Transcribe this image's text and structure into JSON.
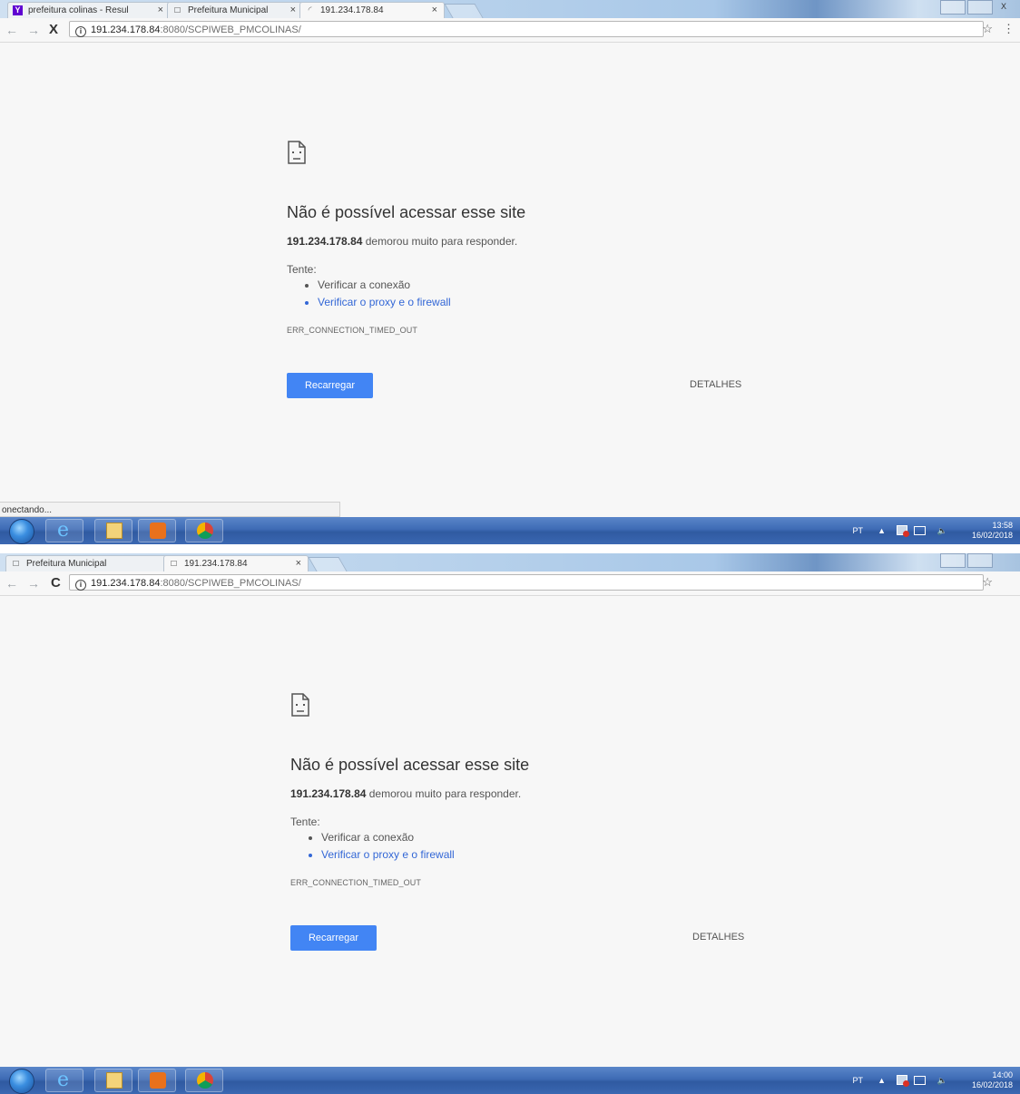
{
  "screens": [
    {
      "tabs": [
        {
          "icon": "yahoo-icon",
          "label": "prefeitura colinas - Resul",
          "close": "×"
        },
        {
          "icon": "page-icon",
          "label": "Prefeitura Municipal",
          "close": "×"
        },
        {
          "icon": "loading-icon",
          "label": "191.234.178.84",
          "close": "×"
        }
      ],
      "url": {
        "host": "191.234.178.84",
        "path": ":8080/SCPIWEB_PMCOLINAS/"
      },
      "reload_symbol": "X",
      "error": {
        "headline": "Não é possível acessar esse site",
        "host": "191.234.178.84",
        "reason": " demorou muito para responder.",
        "try_label": "Tente:",
        "suggestions": [
          "Verificar a conexão",
          "Verificar o proxy e o firewall"
        ],
        "code": "ERR_CONNECTION_TIMED_OUT",
        "reload_button": "Recarregar",
        "details_button": "DETALHES"
      },
      "status_text": "onectando...",
      "tray": {
        "lang": "PT",
        "time": "13:58",
        "date": "16/02/2018"
      }
    },
    {
      "tabs": [
        {
          "icon": "page-icon",
          "label": "Prefeitura Municipal",
          "close": "×"
        },
        {
          "icon": "page-icon",
          "label": "191.234.178.84",
          "close": "×"
        }
      ],
      "url": {
        "host": "191.234.178.84",
        "path": ":8080/SCPIWEB_PMCOLINAS/"
      },
      "reload_symbol": "C",
      "error": {
        "headline": "Não é possível acessar esse site",
        "host": "191.234.178.84",
        "reason": " demorou muito para responder.",
        "try_label": "Tente:",
        "suggestions": [
          "Verificar a conexão",
          "Verificar o proxy e o firewall"
        ],
        "code": "ERR_CONNECTION_TIMED_OUT",
        "reload_button": "Recarregar",
        "details_button": "DETALHES"
      },
      "tray": {
        "lang": "PT",
        "time": "14:00",
        "date": "16/02/2018"
      }
    }
  ],
  "colors": {
    "accent": "#4285f4",
    "link": "#3367d6",
    "taskbar": "#3e6bb5"
  }
}
